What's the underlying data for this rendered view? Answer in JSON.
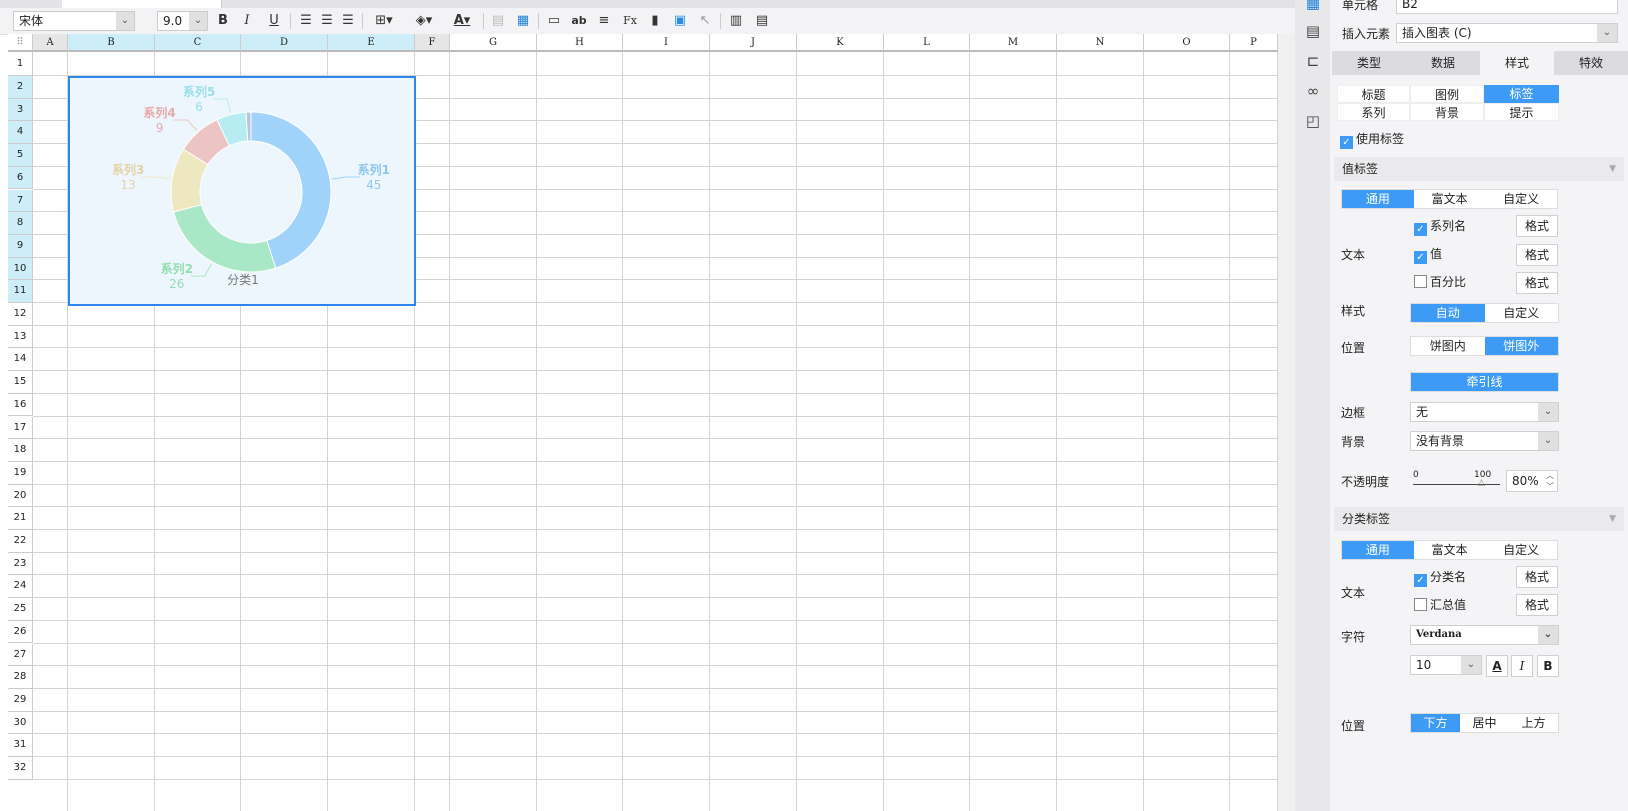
{
  "toolbar": {
    "font": "宋体",
    "size": "9.0",
    "bold": "B",
    "italic": "I",
    "underline": "U"
  },
  "grid": {
    "columns": [
      "A",
      "B",
      "C",
      "D",
      "E",
      "F",
      "G",
      "H",
      "I",
      "J",
      "K",
      "L",
      "M",
      "N",
      "O",
      "P"
    ],
    "rows": [
      "1",
      "2",
      "3",
      "4",
      "5",
      "6",
      "7",
      "8",
      "9",
      "10",
      "11",
      "12",
      "13",
      "14",
      "15",
      "16",
      "17",
      "18",
      "19",
      "20",
      "21",
      "22",
      "23",
      "24",
      "25",
      "26",
      "27",
      "28",
      "29",
      "30",
      "31",
      "32"
    ]
  },
  "chart_data": {
    "type": "pie",
    "variant": "donut",
    "category": "分类1",
    "series": [
      {
        "name": "系列1",
        "value": 45,
        "color": "#9fd3fa"
      },
      {
        "name": "系列2",
        "value": 26,
        "color": "#a9e8c6"
      },
      {
        "name": "系列3",
        "value": 13,
        "color": "#ede8c0"
      },
      {
        "name": "系列4",
        "value": 9,
        "color": "#ecc4c4"
      },
      {
        "name": "系列5",
        "value": 6,
        "color": "#b6ecf2"
      },
      {
        "name": "",
        "value": 1,
        "color": "#b8c4dc"
      }
    ]
  },
  "panel": {
    "cell_label": "单元格",
    "cell_value": "B2",
    "insert_label": "插入元素",
    "insert_value": "插入图表 (C)",
    "tabs": [
      "类型",
      "数据",
      "样式",
      "特效"
    ],
    "subtabs": [
      "标题",
      "图例",
      "标签",
      "系列",
      "背景",
      "提示"
    ],
    "use_label": "使用标签",
    "value_label": {
      "title": "值标签",
      "modes": [
        "通用",
        "富文本",
        "自定义"
      ],
      "text": "文本",
      "series_name": "系列名",
      "value": "值",
      "percent": "百分比",
      "format": "格式",
      "style": "样式",
      "style_opts": [
        "自动",
        "自定义"
      ],
      "position": "位置",
      "position_opts": [
        "饼图内",
        "饼图外"
      ],
      "leader": "牵引线",
      "border": "边框",
      "border_value": "无",
      "background": "背景",
      "background_value": "没有背景",
      "opacity": "不透明度",
      "opacity_min": "0",
      "opacity_max": "100",
      "opacity_value": "80%"
    },
    "category_label": {
      "title": "分类标签",
      "modes": [
        "通用",
        "富文本",
        "自定义"
      ],
      "text": "文本",
      "category_name": "分类名",
      "total": "汇总值",
      "format": "格式",
      "font": "字符",
      "font_value": "Verdana",
      "font_size": "10",
      "position": "位置",
      "position_opts": [
        "下方",
        "居中",
        "上方"
      ]
    }
  }
}
